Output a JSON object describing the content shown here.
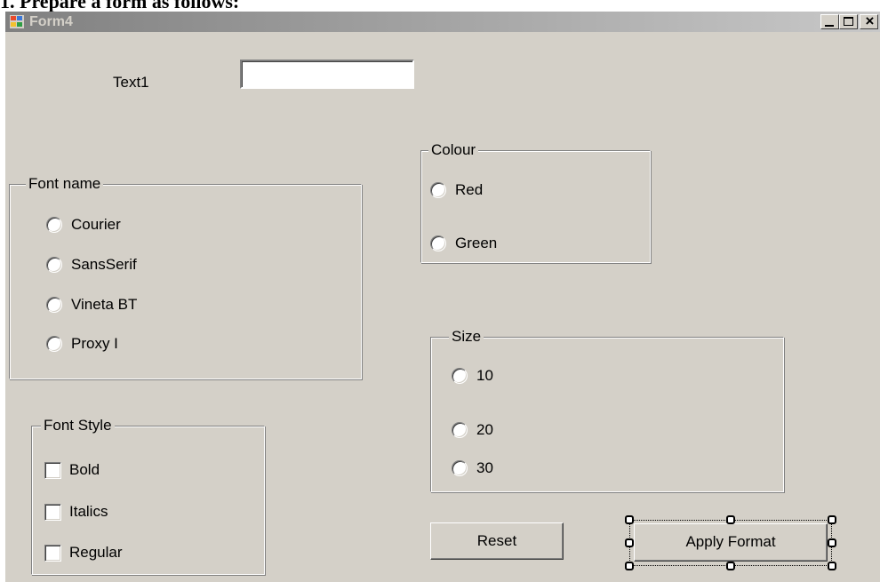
{
  "heading": "1. Prepare a form as follows:",
  "window": {
    "title": "Form4",
    "controls": {
      "minimize": "_",
      "close": "×"
    }
  },
  "text1": {
    "label": "Text1",
    "value": "",
    "placeholder": ""
  },
  "font_name": {
    "title": "Font name",
    "options": [
      "Courier",
      "SansSerif",
      "Vineta BT",
      "Proxy I"
    ]
  },
  "colour": {
    "title": "Colour",
    "options": [
      "Red",
      "Green"
    ]
  },
  "size": {
    "title": "Size",
    "options": [
      "10",
      "20",
      "30"
    ]
  },
  "font_style": {
    "title": "Font Style",
    "options": [
      "Bold",
      "Italics",
      "Regular"
    ]
  },
  "buttons": {
    "reset": "Reset",
    "apply": "Apply Format"
  },
  "colors": {
    "form_background": "#d4d0c8",
    "title_bar_start": "#808080",
    "title_bar_end": "#c8c8c8"
  },
  "icons": [
    "app-icon",
    "minimize-icon",
    "maximize-icon",
    "close-icon"
  ]
}
